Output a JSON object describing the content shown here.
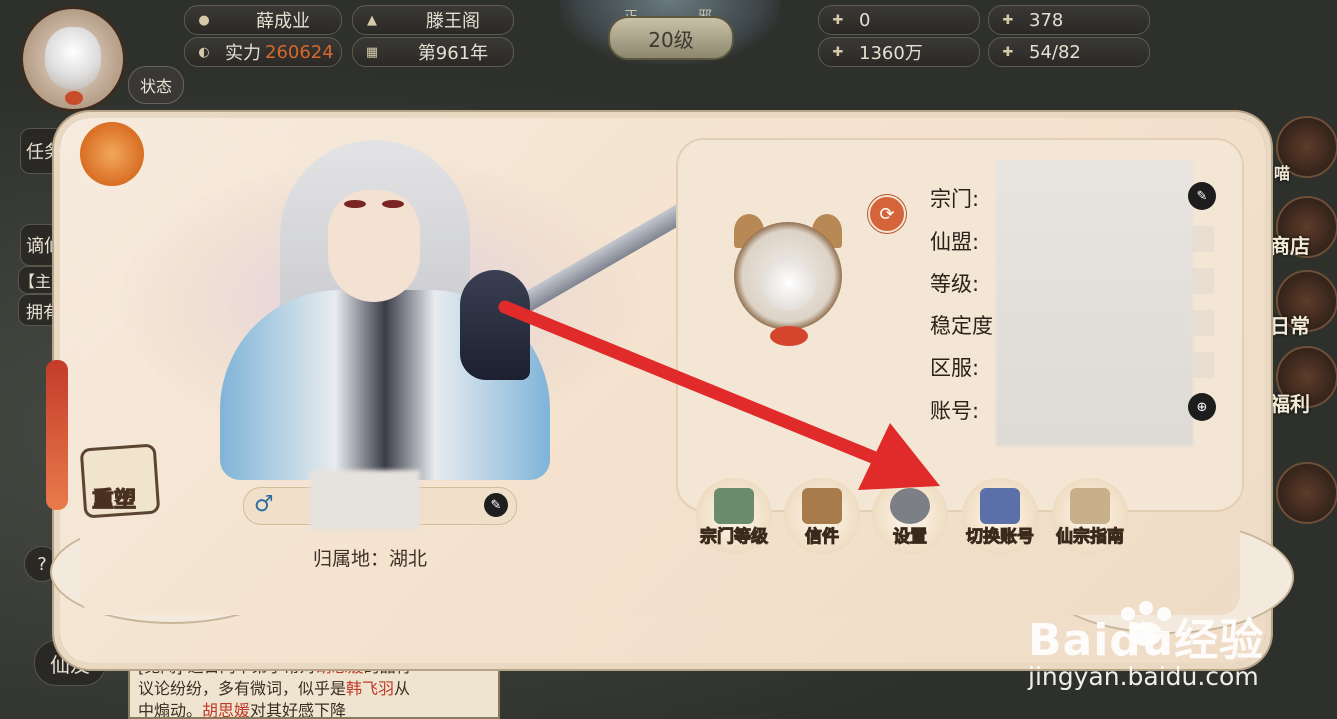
{
  "topbar": {
    "player_name": "薛成业",
    "sect_name": "滕王阁",
    "power_label": "实力",
    "power_value": "260624",
    "year": "第961年",
    "level": "20级",
    "alignment_left": "正",
    "alignment_right": "邪",
    "res1": "0",
    "res2": "378",
    "res3": "1360万",
    "res4": "54/82",
    "status_button": "状态"
  },
  "left_menu": {
    "task": "任务",
    "immortal": "谪仙",
    "main_tag": "【主】",
    "owned": "拥有",
    "friends": "仙友",
    "help": "?"
  },
  "right_menu": {
    "meow": "喵",
    "shop": "商店",
    "daily": "日常",
    "welfare": "福利"
  },
  "message": {
    "prefix": "[见闻]",
    "line1a": "近日门中弟子常对",
    "name1": "胡思媛",
    "line1b": "的品行",
    "line2a": "议论纷纷，多有微词，似乎是",
    "name2": "韩飞羽",
    "line2b": "从",
    "line3a": "中煽动。",
    "name3": "胡思媛",
    "line3b": "对其好感下降"
  },
  "character": {
    "reshape_label": "重塑",
    "gender_symbol": "♂",
    "home_label": "归属地：湖北"
  },
  "info": {
    "sect_label": "宗门:",
    "alliance_label": "仙盟:",
    "level_label": "等级:",
    "stability_label": "稳定度",
    "server_label": "区服:",
    "account_label": "账号:"
  },
  "actions": [
    {
      "label": "宗门等级",
      "color": "#6a8c6a"
    },
    {
      "label": "信件",
      "color": "#a77b4a"
    },
    {
      "label": "设置",
      "color": "#7c7f86"
    },
    {
      "label": "切换账号",
      "color": "#5b6fa8"
    },
    {
      "label": "仙宗指南",
      "color": "#c7b08a"
    }
  ],
  "watermark": {
    "main": "Baidu经验",
    "sub": "jingyan.baidu.com"
  },
  "colors": {
    "arrow": "#e12a2a",
    "accent_orange": "#d4692c",
    "parchment": "#f4e3cf"
  }
}
